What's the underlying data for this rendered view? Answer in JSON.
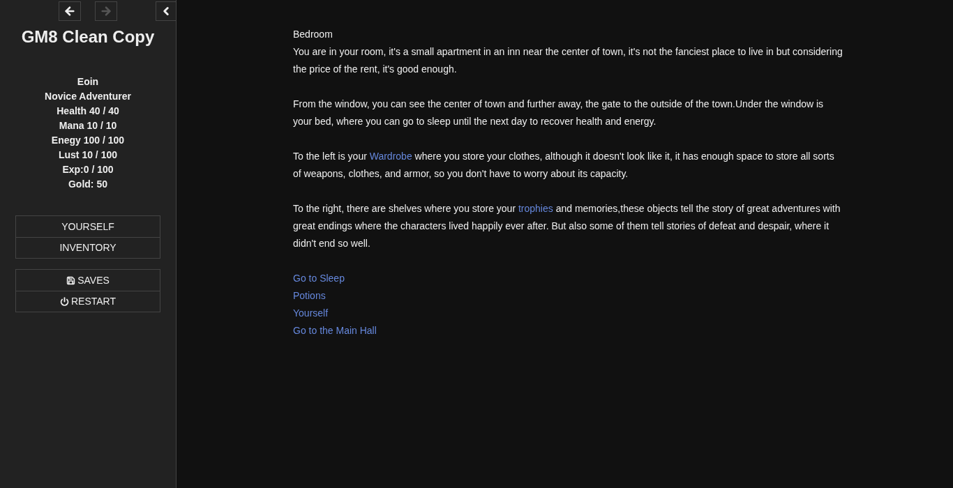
{
  "history": [
    {
      "kind": "back",
      "disabled": false
    },
    {
      "kind": "forward",
      "disabled": true
    }
  ],
  "sidebar": {
    "title": "GM8 Clean Copy",
    "stats": [
      "Eoin",
      "Novice Adventurer",
      "Health 40 / 40",
      "Mana 10 / 10",
      "Enegy 100 / 100",
      "Lust 10 / 100",
      "Exp:0 / 100",
      "Gold: 50"
    ],
    "menu": [
      {
        "label": "YOURSELF"
      },
      {
        "label": "INVENTORY"
      }
    ],
    "actions": [
      {
        "kind": "saves",
        "label": "SAVES"
      },
      {
        "kind": "restart",
        "label": "RESTART"
      }
    ]
  },
  "passage": {
    "title": "Bedroom",
    "paragraphs": [
      [
        {
          "kind": "text",
          "text": "You are in your room, it's a small apartment in an inn near the center of town, it's not the fanciest place to live in but considering the price of the rent, it's good enough."
        }
      ],
      [
        {
          "kind": "text",
          "text": "From the window, you can see the center of town and further away, the gate to the outside of the town.Under the window is your bed, where you can go to sleep until the next day to recover health and energy."
        }
      ],
      [
        {
          "kind": "text",
          "text": "To the left is your "
        },
        {
          "kind": "link",
          "text": "Wardrobe"
        },
        {
          "kind": "text",
          "text": " where you store your clothes, although it doesn't look like it, it has enough space to store all sorts of weapons, clothes, and armor, so you don't have to worry about its capacity."
        }
      ],
      [
        {
          "kind": "text",
          "text": "To the right, there are shelves where you store your "
        },
        {
          "kind": "link",
          "text": "trophies"
        },
        {
          "kind": "text",
          "text": " and memories,these objects tell the story of great adventures with great endings where the characters lived happily ever after. But also some of them tell stories of defeat and despair, where it didn't end so well."
        }
      ]
    ],
    "links": [
      "Go to Sleep",
      "Potions",
      "Yourself",
      "Go to the Main Hall"
    ]
  }
}
